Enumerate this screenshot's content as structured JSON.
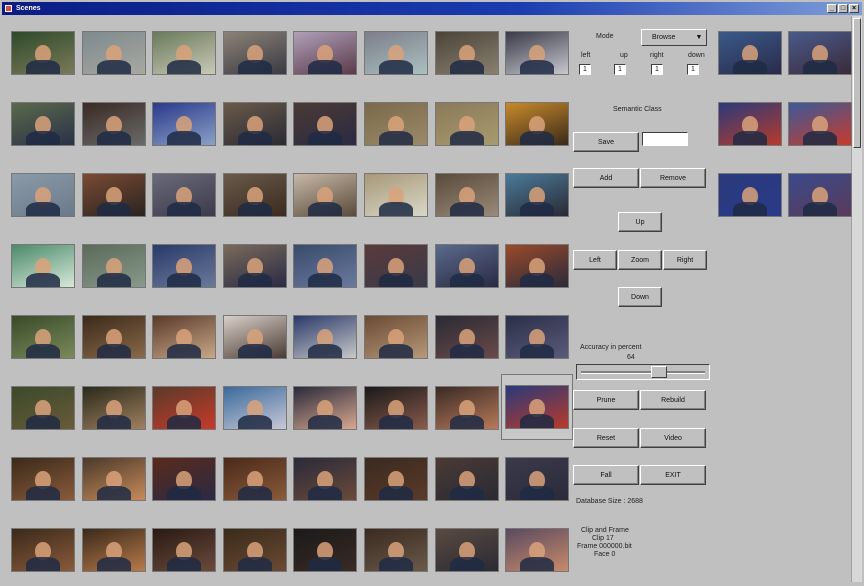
{
  "window": {
    "title": "Scenes",
    "controls": [
      "_",
      "□",
      "×"
    ]
  },
  "colors": {
    "title_bar": "#0a1c84",
    "window_bg": "#c0c0c0"
  },
  "controls": {
    "mode_label": "Mode",
    "mode_value": "Browse",
    "number_labels": [
      "left",
      "up",
      "right",
      "down"
    ],
    "number_values": [
      "1",
      "1",
      "1",
      "1"
    ],
    "semantic_class_label": "Semantic Class",
    "semantic_class_value": "",
    "save_button": "Save",
    "add_button": "Add",
    "remove_button": "Remove",
    "up_button": "Up",
    "left_button": "Left",
    "zoom_button": "Zoom",
    "right_button": "Right",
    "down_button": "Down",
    "accuracy_label": "Accuracy in percent",
    "accuracy_value": "64",
    "accuracy_fraction": 0.64,
    "prune_button": "Prune",
    "rebuild_button": "Rebuild",
    "reset_button": "Reset",
    "video_button": "Video",
    "fall_button": "Fall",
    "exit_button": "EXIT",
    "database_size": "Database Size : 2688",
    "clip_info": [
      "Clip and Frame",
      "Clip 17",
      "Frame 000000.bit",
      "Face 0"
    ]
  },
  "thumbnails": {
    "grid": [
      [
        [
          "#2e4a2a",
          "#7a7a5a"
        ],
        [
          "#7e8a8e",
          "#a8a8a0"
        ],
        [
          "#6a7a5a",
          "#c9c9b8"
        ],
        [
          "#8c8276",
          "#3a3a44"
        ],
        [
          "#b0a0b8",
          "#5a3a4a"
        ],
        [
          "#7c7e8a",
          "#aac0c0"
        ],
        [
          "#4a4438",
          "#8a8070"
        ],
        [
          "#3a3a48",
          "#c8c8d0"
        ]
      ],
      [
        [
          "#5a6a4a",
          "#2a3048"
        ],
        [
          "#3a2a24",
          "#6a6a6a"
        ],
        [
          "#2a3a8a",
          "#8aa0c8"
        ],
        [
          "#6a5a4a",
          "#2a2a34"
        ],
        [
          "#4a3a34",
          "#2a2a44"
        ],
        [
          "#7a6a4a",
          "#9a8a6a"
        ],
        [
          "#8a7a5a",
          "#a89a6e"
        ],
        [
          "#c88a2a",
          "#3a2a1a"
        ]
      ],
      [
        [
          "#8a9aa8",
          "#6a7a8a"
        ],
        [
          "#7a4a34",
          "#2a2420"
        ],
        [
          "#6a6a7a",
          "#3a3a4a"
        ],
        [
          "#6a5a4a",
          "#3a2a20"
        ],
        [
          "#c8b8a8",
          "#5a4a3a"
        ],
        [
          "#a89878",
          "#d8d8c8"
        ],
        [
          "#5a4a3a",
          "#9a8a7a"
        ],
        [
          "#4a7a9a",
          "#2a2a34"
        ]
      ],
      [
        [
          "#4a8a6a",
          "#d8e8d8"
        ],
        [
          "#5a6a5a",
          "#8a9a8a"
        ],
        [
          "#2a3a6a",
          "#6a7a9a"
        ],
        [
          "#7a6a5a",
          "#2a2a44"
        ],
        [
          "#3a4a6a",
          "#6a7aa0"
        ],
        [
          "#5a3a3a",
          "#3a3a4a"
        ],
        [
          "#5a6a8a",
          "#2a2a44"
        ],
        [
          "#9a4a2a",
          "#2a2a3a"
        ]
      ],
      [
        [
          "#3a4a2a",
          "#7a8a5a"
        ],
        [
          "#3a2a1a",
          "#8a6a4a"
        ],
        [
          "#5a3a2a",
          "#c8a888"
        ],
        [
          "#d8d0c8",
          "#4a3a34"
        ],
        [
          "#2a3a6a",
          "#c8c8c8"
        ],
        [
          "#6a4a34",
          "#b89878"
        ],
        [
          "#2a2a34",
          "#6a4a4a"
        ],
        [
          "#2a3048",
          "#5a5a7a"
        ]
      ],
      [
        [
          "#3a4a2a",
          "#6a5a3a"
        ],
        [
          "#2a2a1a",
          "#a08060"
        ],
        [
          "#5a3a2a",
          "#c83a2a"
        ],
        [
          "#3a6a9a",
          "#c8c8d8"
        ],
        [
          "#2a2a3a",
          "#d8a890"
        ],
        [
          "#1a1a1a",
          "#8a5a4a"
        ],
        [
          "#3a2a24",
          "#b87a5a"
        ],
        [
          "#2a2a4a",
          "#9a3a4a"
        ]
      ],
      [
        [
          "#3a2a1a",
          "#8a5a3a"
        ],
        [
          "#4a3a2a",
          "#c88a5a"
        ],
        [
          "#5a2a1a",
          "#2a2a44"
        ],
        [
          "#4a2a1a",
          "#8a5a3a"
        ],
        [
          "#2a2a3a",
          "#6a4a3a"
        ],
        [
          "#3a2a20",
          "#5a3a2a"
        ],
        [
          "#4a3a34",
          "#2a2a34"
        ],
        [
          "#3a3a4a",
          "#2a2a3a"
        ]
      ],
      [
        [
          "#3a2a1a",
          "#8a5a3a"
        ],
        [
          "#3a2a1a",
          "#b87a4a"
        ],
        [
          "#2a1a14",
          "#6a4a3a"
        ],
        [
          "#3a2a1a",
          "#6a4a34"
        ],
        [
          "#1a1a1a",
          "#3a2a24"
        ],
        [
          "#3a2a20",
          "#6a5a4a"
        ],
        [
          "#5a4a40",
          "#2a2a34"
        ],
        [
          "#5a4a60",
          "#c88a6a"
        ]
      ]
    ],
    "results": [
      [
        [
          "#3a5a8a",
          "#2a2a4a"
        ],
        [
          "#4a5a8a",
          "#3a2a3a"
        ]
      ],
      [
        [
          "#2a3a7a",
          "#b83a2a"
        ],
        [
          "#3a5a9a",
          "#c83a2a"
        ]
      ],
      [
        [
          "#2a3a7a",
          "#2a3a8a"
        ],
        [
          "#3a4a8a",
          "#5a3a5a"
        ]
      ]
    ],
    "selected": [
      "#2a3a7a",
      "#b83a2a"
    ]
  }
}
